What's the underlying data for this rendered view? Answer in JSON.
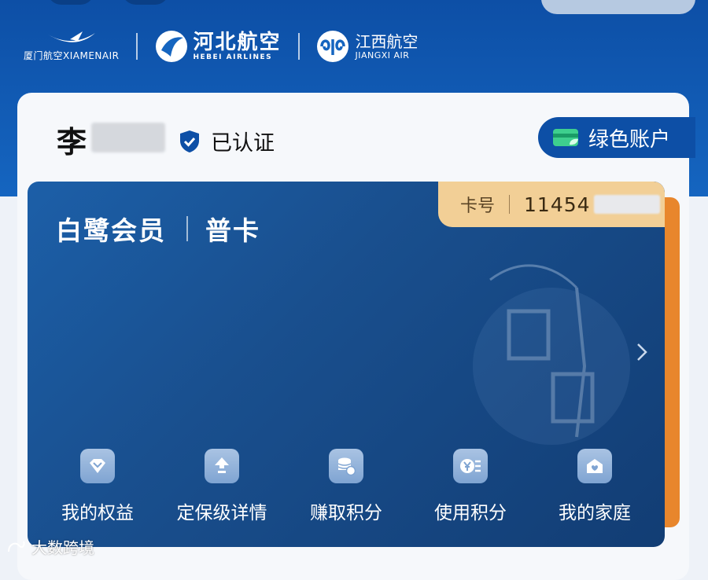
{
  "airlines": {
    "xiamen": {
      "name": "厦门航空XIAMENAIR",
      "icon": "egret-logo-icon"
    },
    "hebei": {
      "name_cn": "河北航空",
      "name_en": "HEBEI AIRLINES",
      "icon": "wing-logo-icon"
    },
    "jiangxi": {
      "name_cn": "江西航空",
      "name_en": "JIANGXI AIR",
      "icon": "jiangxi-logo-icon"
    }
  },
  "user": {
    "name_visible": "李",
    "verified_label": "已认证"
  },
  "green_account": {
    "label": "绿色账户",
    "icon": "green-card-icon"
  },
  "card": {
    "program": "白鹭会员",
    "tier": "普卡",
    "card_no_label": "卡号",
    "card_no_visible": "11454"
  },
  "actions": [
    {
      "label": "我的权益",
      "icon": "diamond-icon"
    },
    {
      "label": "定保级详情",
      "icon": "level-up-icon"
    },
    {
      "label": "赚取积分",
      "icon": "coin-stack-icon"
    },
    {
      "label": "使用积分",
      "icon": "yen-coin-icon"
    },
    {
      "label": "我的家庭",
      "icon": "home-icon"
    }
  ],
  "watermark": "大数跨境",
  "colors": {
    "brand_blue": "#0d4fa6",
    "card_gold": "#f2cf96",
    "accent_orange": "#e8862c"
  }
}
